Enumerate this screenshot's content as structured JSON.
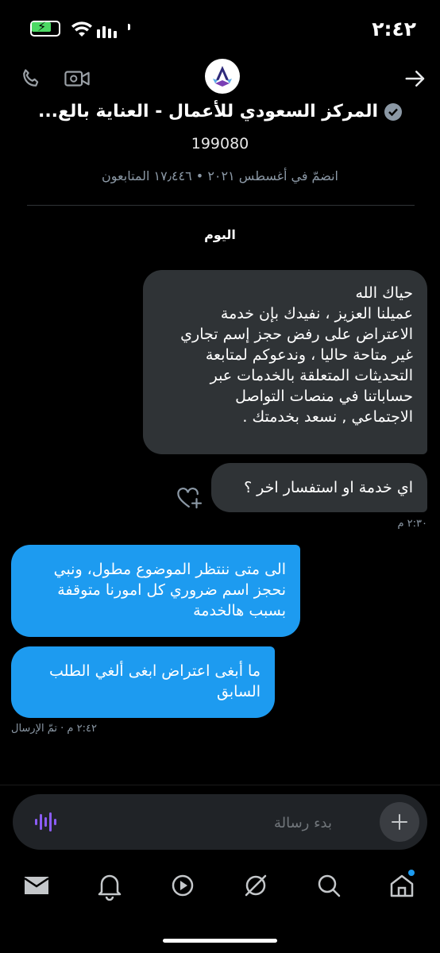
{
  "status_bar": {
    "time": "٢:٤٢"
  },
  "header": {
    "title": "المركز السعودي للأعمال - العناية بالع...",
    "subtitle": "199080",
    "meta": "انضمّ في أغسطس ٢٠٢١ • ١٧٫٤٤٦ المتابعون"
  },
  "conversation": {
    "day_label": "اليوم",
    "messages": [
      {
        "direction": "incoming",
        "text": "حياك الله\nعميلنا العزيز ، نفيدك بإن خدمة\nالاعتراض على رفض حجز إسم تجاري\nغير متاحة حاليا ، وندعوكم لمتابعة\nالتحديثات المتعلقة بالخدمات عبر\nحساباتنا في منصات التواصل\nالاجتماعي , نسعد بخدمتك ."
      },
      {
        "direction": "incoming",
        "text": "اي خدمة او استفسار اخر ؟"
      },
      {
        "direction": "outgoing",
        "text": "الى متى ننتظر الموضوع مطول، ونبي\nنحجز اسم ضروري كل امورنا متوقفة\nبسبب هالخدمة"
      },
      {
        "direction": "outgoing",
        "text": "ما أبغى اعتراض ابغى ألغي الطلب\nالسابق"
      }
    ],
    "incoming_time": "٢:٣٠ م",
    "outgoing_status": "٢:٤٢ م · تمّ الإرسال"
  },
  "composer": {
    "placeholder": "بدء رسالة"
  },
  "icons": {
    "back": "arrow-right-icon",
    "call": "phone-icon",
    "video": "video-icon",
    "react": "heart-plus-icon",
    "voice": "waveform-icon",
    "add": "plus-icon"
  },
  "tabs": [
    "mail-icon",
    "bell-icon",
    "play-icon",
    "grok-icon",
    "search-icon",
    "home-icon"
  ],
  "colors": {
    "accent": "#1d9bf0",
    "incoming_bubble": "#2f3336",
    "voice": "#8b5cf6",
    "background": "#000000"
  }
}
